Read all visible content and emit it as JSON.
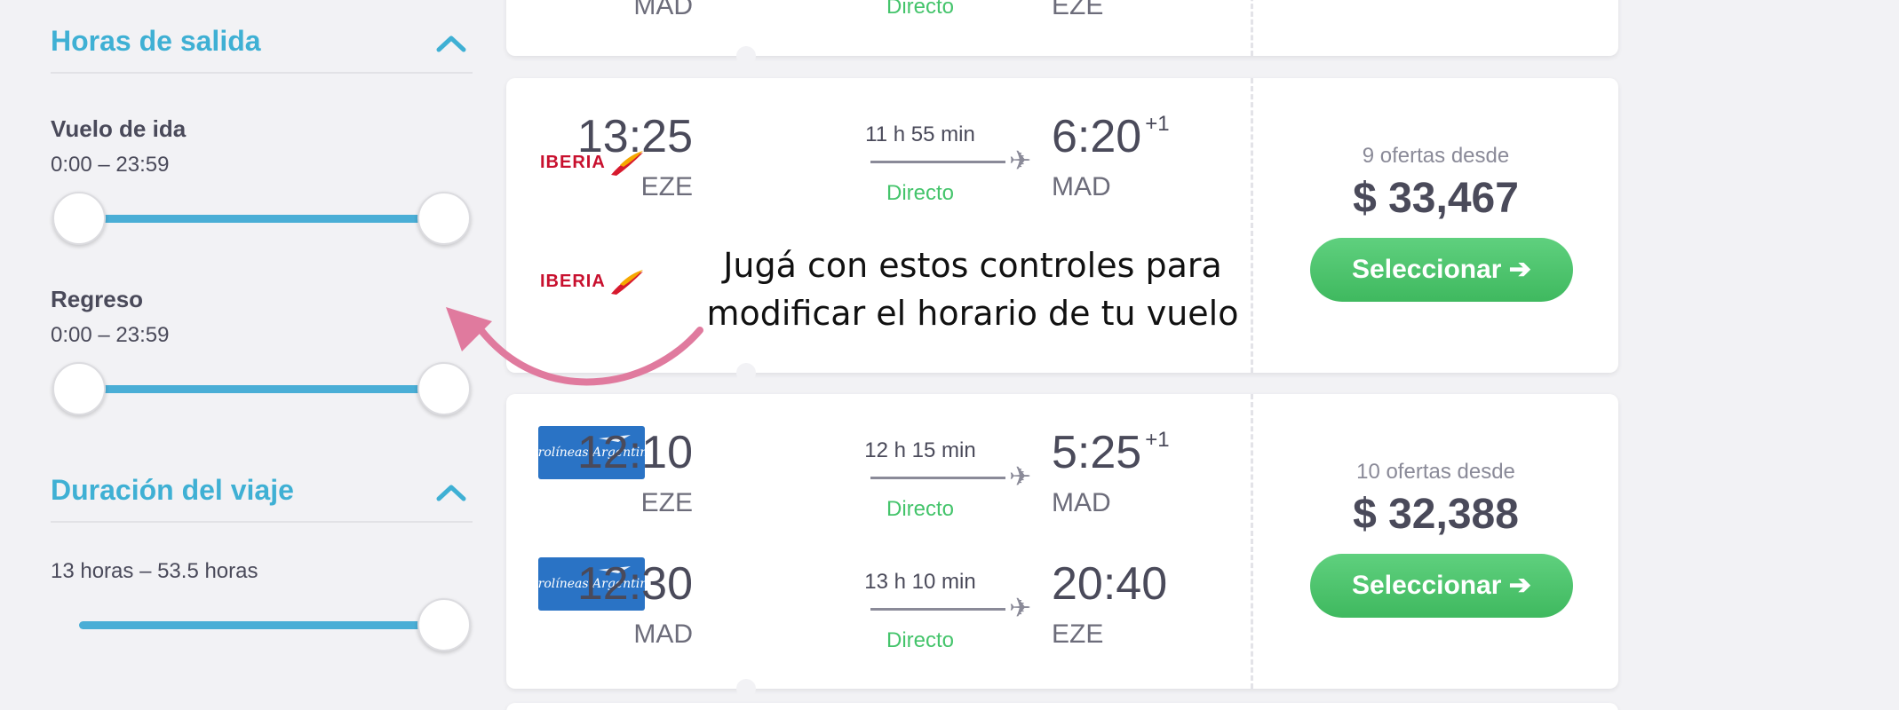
{
  "filters": {
    "departure_times": {
      "title": "Horas de salida",
      "outbound": {
        "label": "Vuelo de ida",
        "range": "0:00 – 23:59"
      },
      "return": {
        "label": "Regreso",
        "range": "0:00 – 23:59"
      }
    },
    "trip_duration": {
      "title": "Duración del viaje",
      "range": "13 horas – 53.5 horas"
    }
  },
  "top_card": {
    "code_left": "MAD",
    "stops": "Directo",
    "code_right": "EZE"
  },
  "results": [
    {
      "airline": "IBERIA",
      "outbound": {
        "dep_time": "13:25",
        "dep_code": "EZE",
        "duration": "11 h 55 min",
        "stops": "Directo",
        "arr_time": "6:20",
        "arr_day": "+1",
        "arr_code": "MAD"
      },
      "offers": "9 ofertas desde",
      "price": "$ 33,467",
      "select_label": "Seleccionar ➔"
    },
    {
      "airline": "Aerolíneas Argentinas",
      "outbound": {
        "dep_time": "12:10",
        "dep_code": "EZE",
        "duration": "12 h 15 min",
        "stops": "Directo",
        "arr_time": "5:25",
        "arr_day": "+1",
        "arr_code": "MAD"
      },
      "return": {
        "dep_time": "12:30",
        "dep_code": "MAD",
        "duration": "13 h 10 min",
        "stops": "Directo",
        "arr_time": "20:40",
        "arr_code": "EZE"
      },
      "offers": "10 ofertas desde",
      "price": "$ 32,388",
      "select_label": "Seleccionar ➔"
    }
  ],
  "annotation": {
    "line1": "Jugá con estos controles para",
    "line2": "modificar el horario de tu vuelo"
  },
  "colors": {
    "accent": "#3fb0d4",
    "green": "#44c46b",
    "annotation_arrow": "#e07a9e"
  }
}
